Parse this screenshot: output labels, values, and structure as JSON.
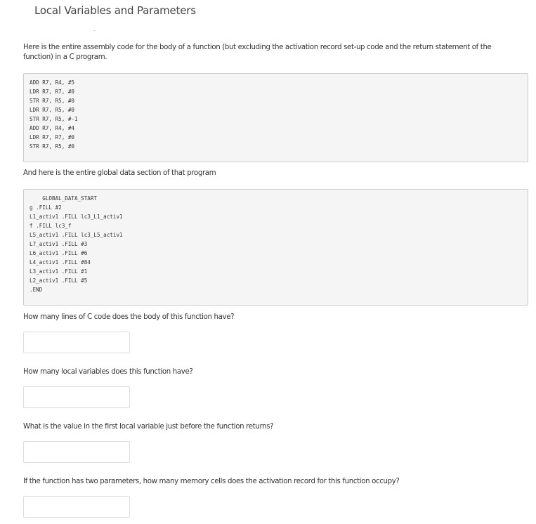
{
  "page": {
    "title": "Local Variables and Parameters"
  },
  "intro": {
    "assembly_text": "Here is the entire assembly code for the body of a function (but excluding the activation record set-up code and the return statement of the function) in a C program.",
    "global_text": "And here is the entire global data section of that program"
  },
  "assembly_code": [
    "ADD R7, R4, #5",
    "LDR R7, R7, #0",
    "STR R7, R5, #0",
    "LDR R7, R5, #0",
    "STR R7, R5, #-1",
    "ADD R7, R4, #4",
    "LDR R7, R7, #0",
    "STR R7, R5, #0"
  ],
  "global_data": [
    "    GLOBAL_DATA_START",
    "g .FILL #2",
    "L1_activ1 .FILL lc3_L1_activ1",
    "f .FILL lc3_f",
    "L5_activ1 .FILL lc3_L5_activ1",
    "L7_activ1 .FILL #3",
    "L6_activ1 .FILL #6",
    "L4_activ1 .FILL #84",
    "L3_activ1 .FILL #1",
    "L2_activ1 .FILL #5",
    ".END"
  ],
  "questions": [
    {
      "label": "How many lines of C code does the body of this function have?",
      "value": ""
    },
    {
      "label": "How many local variables does this function have?",
      "value": ""
    },
    {
      "label": "What is the value in the first local variable just before the function returns?",
      "value": ""
    },
    {
      "label": "If the function has two parameters, how many memory cells does the activation record for this function occupy?",
      "value": ""
    }
  ]
}
